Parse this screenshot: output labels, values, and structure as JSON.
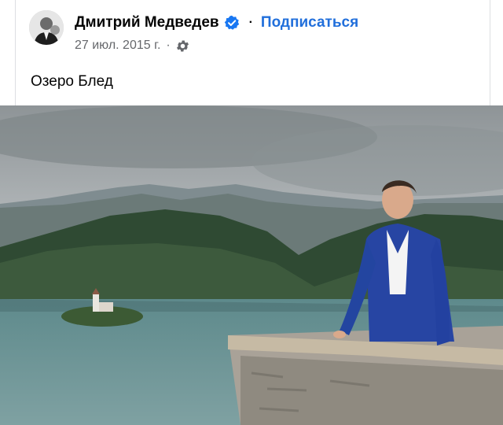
{
  "post": {
    "author": "Дмитрий Медведев",
    "verified_icon": "verified-badge-icon",
    "separator": "·",
    "follow_label": "Подписаться",
    "date": "27 июл. 2015 г.",
    "meta_separator": "·",
    "privacy_icon": "gear-icon",
    "text": "Озеро Блед"
  },
  "colors": {
    "link": "#216fdb",
    "verified": "#1877f2",
    "meta": "#65676b",
    "text": "#050505"
  }
}
